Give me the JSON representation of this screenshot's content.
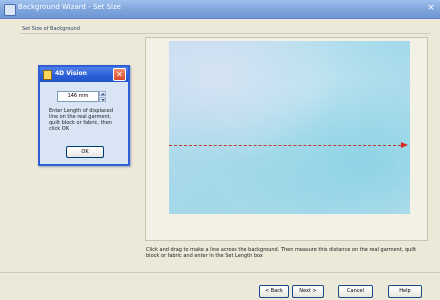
{
  "window": {
    "title": "Background Wizard - Set Size",
    "close_glyph": "×"
  },
  "page": {
    "subtitle": "Set Size of Background"
  },
  "dialog": {
    "title": "4D Vision",
    "close_glyph": "✕",
    "length_value": "146 mm",
    "message": "Enter Length of displaced line on the real garment, quilt block or fabric, then click OK",
    "ok_label": "OK"
  },
  "preview": {
    "instructions": "Click and drag to make a line across the background. Then measure this distance on the real garment, quilt block or fabric and enter in the Set Length box"
  },
  "buttons": {
    "back": "< Back",
    "next": "Next >",
    "cancel": "Cancel",
    "help": "Help"
  },
  "colors": {
    "title_bar": "#7ea4dc",
    "dialog_title_bar": "#2b5fd8",
    "dialog_close": "#d84a2a",
    "measure_line": "#c0392b",
    "window_bg": "#ece9d8"
  },
  "icons": {
    "app": "wizard-app-icon",
    "dialog": "vision-app-icon",
    "close": "close-icon",
    "spin_up": "spin-up-icon",
    "spin_down": "spin-down-icon",
    "arrow": "arrow-right-icon"
  }
}
